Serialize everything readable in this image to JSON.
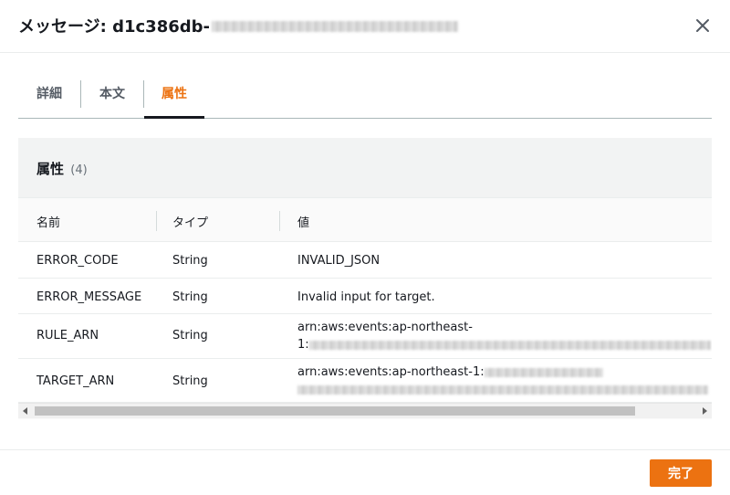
{
  "modal": {
    "title": "メッセージ: d1c386db-"
  },
  "tabs": [
    {
      "label": "詳細",
      "active": false
    },
    {
      "label": "本文",
      "active": false
    },
    {
      "label": "属性",
      "active": true
    }
  ],
  "attributes": {
    "title": "属性",
    "count": "(4)",
    "columns": [
      "名前",
      "タイプ",
      "値"
    ],
    "rows": [
      {
        "name": "ERROR_CODE",
        "type": "String",
        "value": "INVALID_JSON"
      },
      {
        "name": "ERROR_MESSAGE",
        "type": "String",
        "value": "Invalid input for target."
      },
      {
        "name": "RULE_ARN",
        "type": "String",
        "value_line1": "arn:aws:events:ap-northeast-",
        "value_line2": "1:"
      },
      {
        "name": "TARGET_ARN",
        "type": "String",
        "value_line1": "arn:aws:events:ap-northeast-1:"
      }
    ]
  },
  "footer": {
    "done_label": "完了"
  },
  "colors": {
    "accent": "#ec7211",
    "text": "#16191f",
    "muted": "#545b64"
  },
  "icons": {
    "close": "close-icon",
    "scroll_left": "caret-left-icon",
    "scroll_right": "caret-right-icon"
  }
}
